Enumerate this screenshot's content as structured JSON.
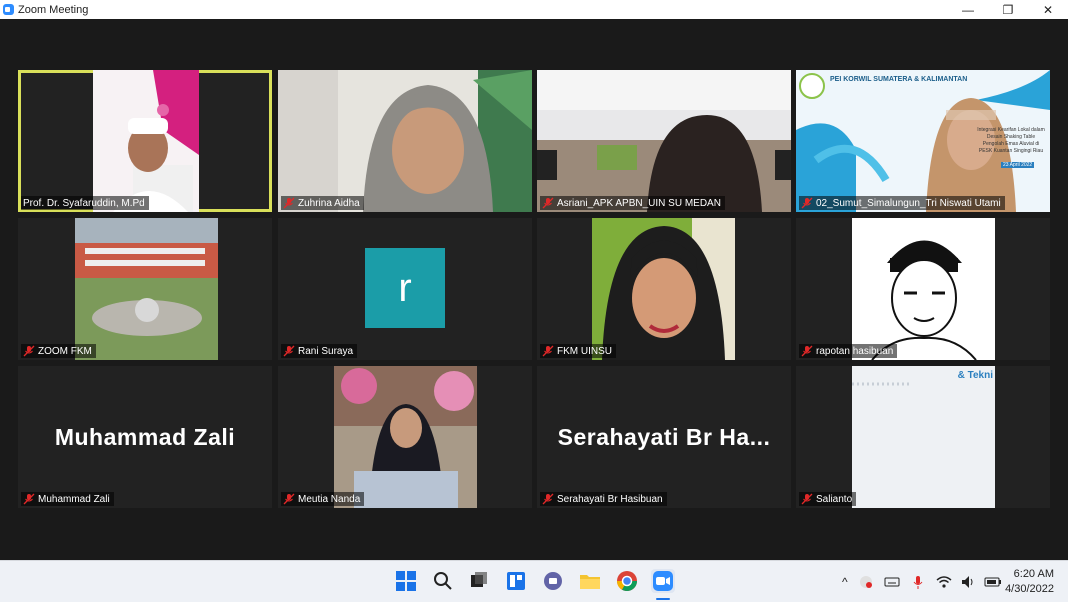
{
  "window": {
    "title": "Zoom Meeting"
  },
  "window_controls": {
    "minimize": "—",
    "restore": "❐",
    "close": "✕"
  },
  "participants": [
    {
      "name": "Prof. Dr. Syafaruddin, M.Pd",
      "muted": false,
      "active_speaker": true,
      "video": true
    },
    {
      "name": "Zuhrina Aidha",
      "muted": true,
      "video": true
    },
    {
      "name": "Asriani_APK APBN_UIN SU MEDAN",
      "muted": true,
      "video": true
    },
    {
      "name": "02_Sumut_Simalungun_Tri Niswati Utami",
      "muted": true,
      "video": true
    },
    {
      "name": "ZOOM FKM",
      "muted": true,
      "video": true
    },
    {
      "name": "Rani Suraya",
      "muted": true,
      "video": false,
      "avatar_letter": "r"
    },
    {
      "name": "FKM UINSU",
      "muted": true,
      "video": true
    },
    {
      "name": "rapotan hasibuan",
      "muted": true,
      "video": true
    },
    {
      "name": "Muhammad Zali",
      "muted": true,
      "video": false,
      "display_text": "Muhammad Zali"
    },
    {
      "name": "Meutia Nanda",
      "muted": true,
      "video": true
    },
    {
      "name": "Serahayati Br Hasibuan",
      "muted": true,
      "video": false,
      "display_text": "Serahayati Br Ha..."
    },
    {
      "name": "Salianto",
      "muted": true,
      "video": true
    }
  ],
  "slide_text": {
    "header": "PEI KORWIL SUMATERA & KALIMANTAN",
    "body": "Integrasi Kearifan Lokal dalam Desain Shaking Table Pengolah Emas Aluvial di PESK Kuantan Singingi Riau",
    "date": "23 April 2022"
  },
  "salianto_screen_text": "& Tekni",
  "taskbar": {
    "icons": [
      "windows-start-icon",
      "search-icon",
      "task-view-icon",
      "widgets-icon",
      "teams-chat-icon",
      "file-explorer-icon",
      "chrome-icon",
      "zoom-icon"
    ],
    "tray_chevron": "^",
    "clock_time": "6:20 AM",
    "clock_date": "4/30/2022"
  },
  "colors": {
    "active_border": "#d9e05a",
    "avatar_bg": "#1b9da8",
    "mute_red": "#e02828",
    "zoom_blue": "#2d8cff"
  }
}
